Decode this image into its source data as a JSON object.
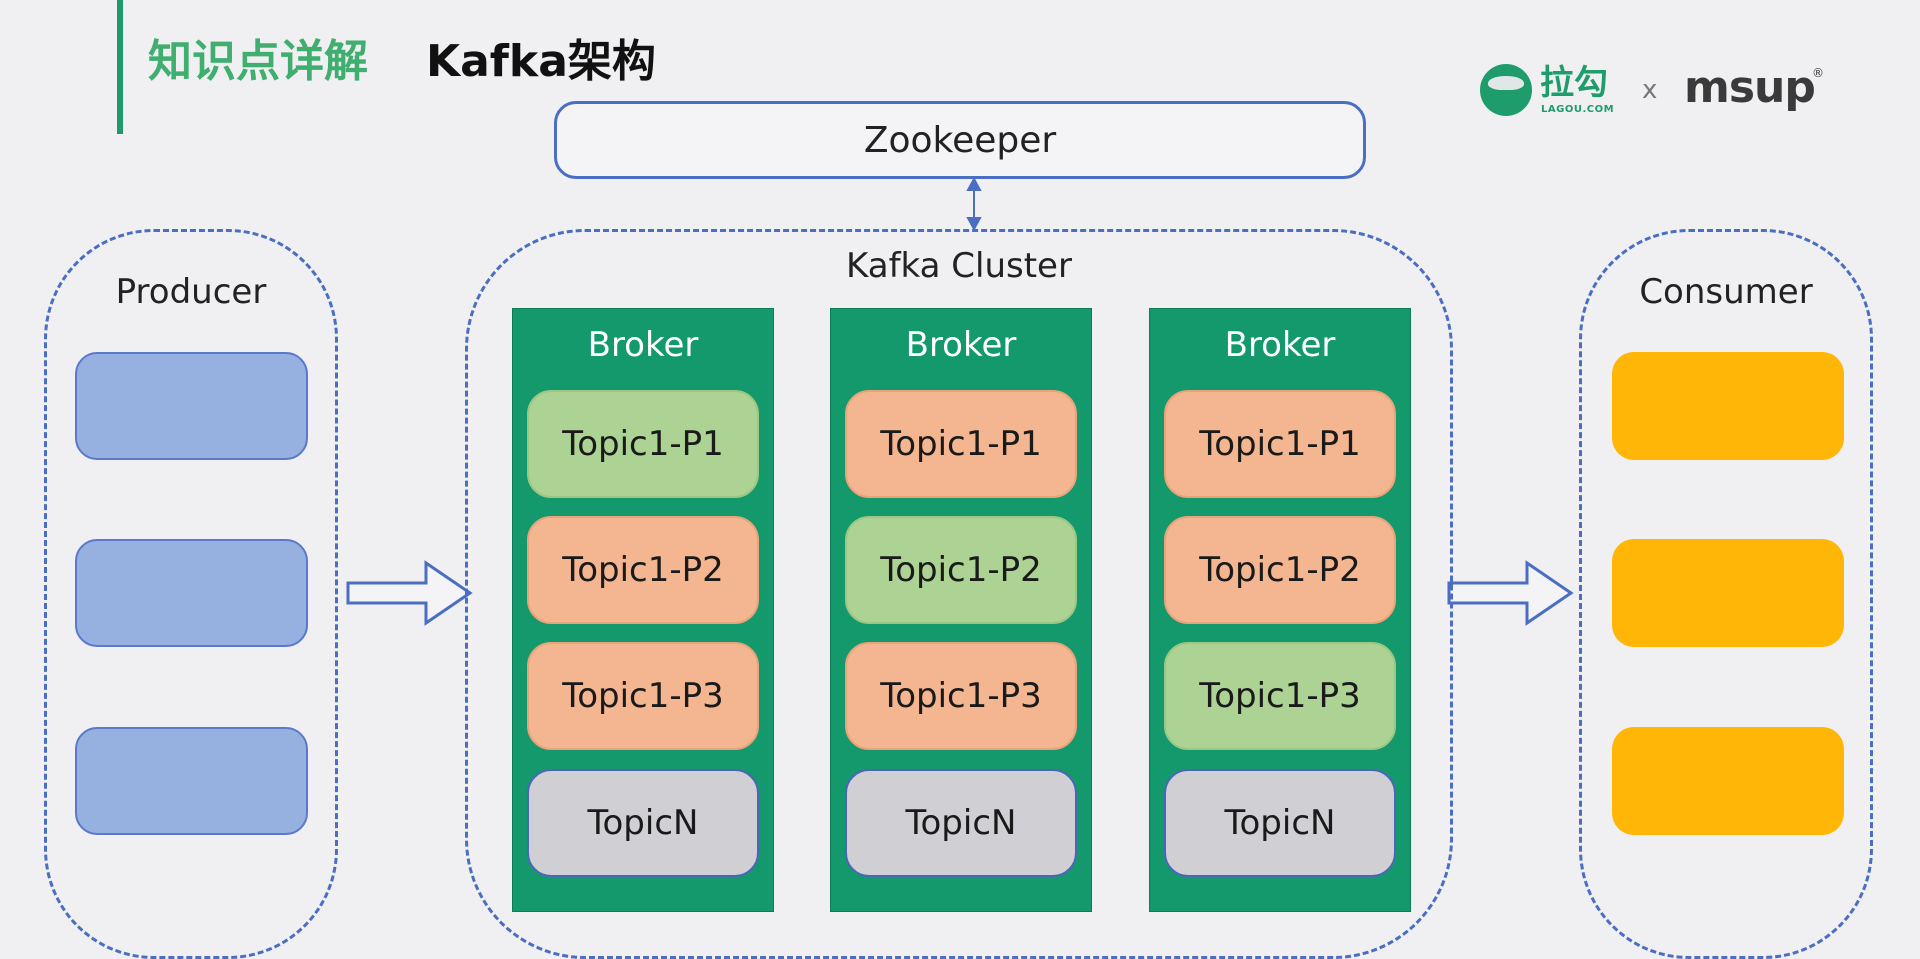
{
  "header": {
    "section_label": "知识点详解",
    "title": "Kafka架构",
    "accent_color": "#1f9a6b"
  },
  "logos": {
    "lagou_cn": "拉勾",
    "lagou_en": "LAGOU.COM",
    "separator": "x",
    "partner": "msup",
    "registered_mark": "®"
  },
  "diagram": {
    "zookeeper_label": "Zookeeper",
    "producer_label": "Producer",
    "cluster_label": "Kafka Cluster",
    "consumer_label": "Consumer",
    "brokers": [
      {
        "label": "Broker",
        "topics": [
          {
            "label": "Topic1-P1",
            "role": "leader"
          },
          {
            "label": "Topic1-P2",
            "role": "follower"
          },
          {
            "label": "Topic1-P3",
            "role": "follower"
          },
          {
            "label": "TopicN",
            "role": "other"
          }
        ]
      },
      {
        "label": "Broker",
        "topics": [
          {
            "label": "Topic1-P1",
            "role": "follower"
          },
          {
            "label": "Topic1-P2",
            "role": "leader"
          },
          {
            "label": "Topic1-P3",
            "role": "follower"
          },
          {
            "label": "TopicN",
            "role": "other"
          }
        ]
      },
      {
        "label": "Broker",
        "topics": [
          {
            "label": "Topic1-P1",
            "role": "follower"
          },
          {
            "label": "Topic1-P2",
            "role": "follower"
          },
          {
            "label": "Topic1-P3",
            "role": "leader"
          },
          {
            "label": "TopicN",
            "role": "other"
          }
        ]
      }
    ],
    "colors": {
      "broker": "#13996c",
      "leader_partition": "#acd294",
      "follower_partition": "#f4b690",
      "other_topic": "#d0cfd4",
      "producer": "#96b0e0",
      "consumer": "#ffb606",
      "outline": "#4a6ec2"
    }
  }
}
